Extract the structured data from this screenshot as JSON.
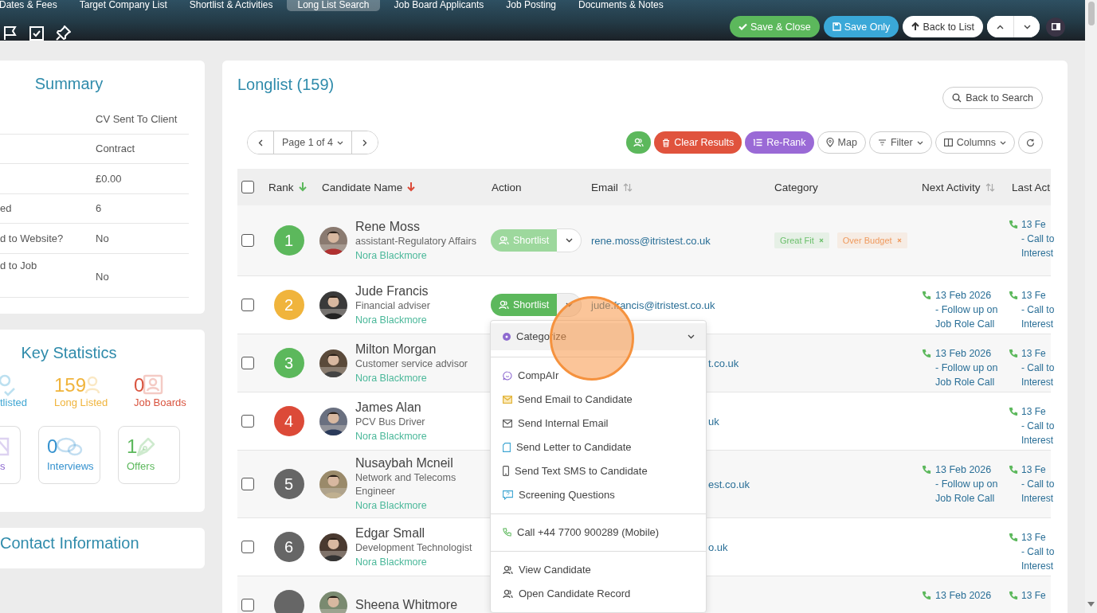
{
  "header": {
    "tabs": [
      {
        "label": "Dates & Fees",
        "selected": false
      },
      {
        "label": "Target Company List",
        "selected": false
      },
      {
        "label": "Shortlist & Activities",
        "selected": false
      },
      {
        "label": "Long List Search",
        "selected": true
      },
      {
        "label": "Job Board Applicants",
        "selected": false
      },
      {
        "label": "Job Posting",
        "selected": false
      },
      {
        "label": "Documents & Notes",
        "selected": false
      }
    ],
    "buttons": [
      {
        "label": "Save & Close",
        "kind": "save-close"
      },
      {
        "label": "Save Only",
        "kind": "save"
      },
      {
        "label": "Back to List",
        "kind": "back"
      }
    ]
  },
  "summary": {
    "title": "Summary",
    "rows": [
      {
        "value": "CV Sent To Client"
      },
      {
        "value": "Contract"
      },
      {
        "value": "£0.00"
      },
      {
        "label": "ed",
        "value": "6"
      },
      {
        "label": "d to Website?",
        "value": "No"
      },
      {
        "label": "d to Job",
        "value": "No"
      }
    ]
  },
  "key_statistics": {
    "title": "Key Statistics",
    "stats": [
      {
        "kind": "shortlisted",
        "label": "tlisted",
        "color": "#3fa6d3",
        "boxed": false
      },
      {
        "kind": "longlisted",
        "number": "159",
        "label": "Long Listed",
        "color": "#f0b43c",
        "boxed": false
      },
      {
        "kind": "job-boards",
        "number": "0",
        "label": "Job Boards",
        "color": "#d9543f",
        "boxed": false
      },
      {
        "kind": "applications",
        "label": "s",
        "color": "#8e6ad0",
        "boxed": true
      },
      {
        "kind": "interviews",
        "number": "0",
        "label": "Interviews",
        "color": "#3592cf",
        "boxed": true
      },
      {
        "kind": "offers",
        "number": "1",
        "label": "Offers",
        "color": "#5cb85c",
        "boxed": true
      }
    ]
  },
  "contact": {
    "title": "Contact Information"
  },
  "longlist": {
    "title": "Longlist (159)",
    "back_button": "Back to Search",
    "pager": "Page 1 of 4",
    "toolbar": [
      {
        "kind": "shortlist",
        "color": "#5cb85c"
      },
      {
        "kind": "clear",
        "label": "Clear Results",
        "color": "#e0533d"
      },
      {
        "kind": "rerank",
        "label": "Re-Rank",
        "color": "#9a6ad6"
      },
      {
        "kind": "map",
        "label": "Map"
      },
      {
        "kind": "filter",
        "label": "Filter"
      },
      {
        "kind": "columns",
        "label": "Columns"
      },
      {
        "kind": "refresh"
      }
    ],
    "select_all": {
      "checked": false
    },
    "columns": [
      {
        "label": "Rank",
        "sorted": true,
        "primary": true
      },
      {
        "label": "Candidate Name",
        "sorted": true,
        "primary": false
      },
      {
        "label": "Action"
      },
      {
        "label": "Email",
        "sorted": false
      },
      {
        "label": "Category"
      },
      {
        "label": "Next Activity",
        "sorted": false
      },
      {
        "label": "Last Act"
      }
    ],
    "rows": [
      {
        "checked": false,
        "rank": "1",
        "color": "#5cb85c",
        "name": "Rene Moss",
        "title": "assistant-Regulatory Affairs",
        "recruiter": "Nora Blackmore",
        "action": {
          "label": "Shortlist",
          "disabled": true,
          "menu_open": false
        },
        "email": "rene.moss@itristest.co.uk",
        "categories": [
          {
            "label": "Great Fit",
            "color": "#6cbf6c"
          },
          {
            "label": "Over Budget",
            "color": "#ef9a5e"
          }
        ],
        "last_activity": [
          "13 Fe",
          "- Call to",
          "Interest"
        ]
      },
      {
        "checked": false,
        "rank": "2",
        "color": "#f0b43c",
        "name": "Jude Francis",
        "title": "Financial adviser",
        "recruiter": "Nora Blackmore",
        "action": {
          "label": "Shortlist",
          "disabled": false,
          "menu_open": true
        },
        "email": "jude.francis@itristest.co.uk",
        "next_activity": [
          "13 Feb 2026",
          "- Follow up on",
          "Job Role Call"
        ],
        "last_activity": [
          "13 Fe",
          "- Call to",
          "Interest"
        ]
      },
      {
        "checked": false,
        "rank": "3",
        "color": "#5cb85c",
        "name": "Milton Morgan",
        "title": "Customer service advisor",
        "recruiter": "Nora Blackmore",
        "email": "t.co.uk",
        "next_activity": [
          "13 Feb 2026",
          "- Follow up on",
          "Job Role Call"
        ],
        "last_activity": [
          "13 Fe",
          "- Call to",
          "Interest"
        ]
      },
      {
        "checked": false,
        "rank": "4",
        "color": "#dc4a38",
        "name": "James Alan",
        "title": "PCV Bus Driver",
        "recruiter": "Nora Blackmore",
        "email": "uk",
        "last_activity": [
          "13 Fe",
          "- Call to",
          "Interest"
        ]
      },
      {
        "checked": false,
        "rank": "5",
        "color": "#666666",
        "name": "Nusaybah Mcneil",
        "title": "Network and Telecoms Engineer",
        "recruiter": "Nora Blackmore",
        "email": "est.co.uk",
        "next_activity": [
          "13 Feb 2026",
          "- Follow up on",
          "Job Role Call"
        ],
        "last_activity": [
          "13 Fe",
          "- Call to",
          "Interest"
        ]
      },
      {
        "checked": false,
        "rank": "6",
        "color": "#666666",
        "name": "Edgar Small",
        "title": "Development Technologist",
        "recruiter": "Nora Blackmore",
        "email": "o.uk",
        "last_activity": [
          "13 Fe",
          "- Call to",
          "Interest"
        ]
      },
      {
        "checked": false,
        "color": "#666666",
        "name": "Sheena Whitmore",
        "next_activity": [
          "13 Feb 2026"
        ],
        "last_activity": [
          "13 Fe"
        ]
      }
    ],
    "menu": {
      "header": "Categorize",
      "groups": [
        {
          "items": [
            {
              "kind": "ai",
              "label": "CompAIr"
            },
            {
              "kind": "email",
              "label": "Send Email to Candidate"
            },
            {
              "kind": "internal-email",
              "label": "Send Internal Email"
            },
            {
              "kind": "letter",
              "label": "Send Letter to Candidate"
            },
            {
              "kind": "sms",
              "label": "Send Text SMS to Candidate"
            },
            {
              "kind": "questions",
              "label": "Screening Questions"
            }
          ]
        },
        {
          "items": [
            {
              "kind": "phone",
              "label": "Call +44 7700 900289 (Mobile)"
            }
          ]
        },
        {
          "items": [
            {
              "kind": "person",
              "label": "View Candidate"
            },
            {
              "kind": "person",
              "label": "Open Candidate Record"
            }
          ]
        }
      ]
    }
  }
}
